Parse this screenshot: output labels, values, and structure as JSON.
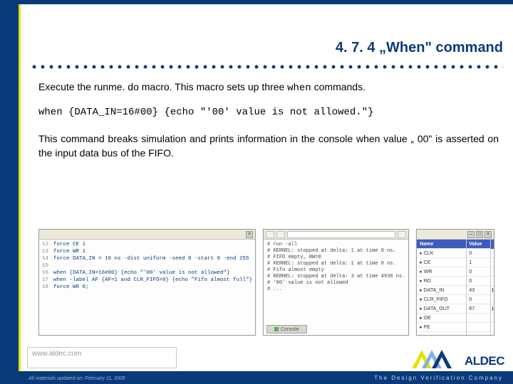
{
  "title": "4. 7. 4 „When\" command",
  "para1_a": "Execute the runme. do macro.  This macro sets up three ",
  "para1_b": "when",
  "para1_c": " commands.",
  "code": "when  {DATA_IN=16#00}  {echo  \"'00'  value  is  not allowed.\"}",
  "para2": "This command breaks simulation and prints information in the console when value „ 00\" is asserted on the input data bus of the FIFO.",
  "dofile": {
    "lines": [
      "force CE 1",
      "force WR 1",
      "force DATA_IN = 10 ns -dist uniform -seed 0 -start 0 -end 255",
      "",
      "when {DATA_IN=16#00} {echo \"'00' value is not allowed\"}",
      "when -label AF {AF=1 and CLR_FIFO=0} {echo \"Fifo almost full\"}",
      "force WR 0;"
    ],
    "startno": 12
  },
  "console": {
    "lines": [
      "# run -all",
      "# KERNEL: stopped at delta: 1 at time 0 ns.",
      "# FIFO empty, RW=0",
      "# KERNEL: stopped at delta: 1 at time 0 ns.",
      "# Fifo almost empty",
      "# KERNEL: stopped at delta: 3 at time 4936 ns.",
      "# '00' value is not allowed",
      "# ..."
    ],
    "tab": "Console"
  },
  "wave": {
    "headers": [
      "Name",
      "Value"
    ],
    "signals": [
      {
        "name": "CLK",
        "val": "0",
        "kind": "clock"
      },
      {
        "name": "CE",
        "val": "1",
        "kind": "high"
      },
      {
        "name": "WR",
        "val": "0",
        "kind": "low"
      },
      {
        "name": "RD",
        "val": "0",
        "kind": "low"
      },
      {
        "name": "DATA_IN",
        "val": "43",
        "kind": "bus"
      },
      {
        "name": "CLR_FIFO",
        "val": "0",
        "kind": "low"
      },
      {
        "name": "DATA_OUT",
        "val": "87",
        "kind": "bus2"
      },
      {
        "name": "OE",
        "val": "",
        "kind": "low"
      },
      {
        "name": "FE",
        "val": "",
        "kind": "low"
      }
    ]
  },
  "footer": {
    "url": "www.aldec.com",
    "note": "All materials updated on: February 11, 2005",
    "brand": "ALDEC",
    "tagline": "The Design Verification Company"
  },
  "icons": {
    "close": "×"
  }
}
